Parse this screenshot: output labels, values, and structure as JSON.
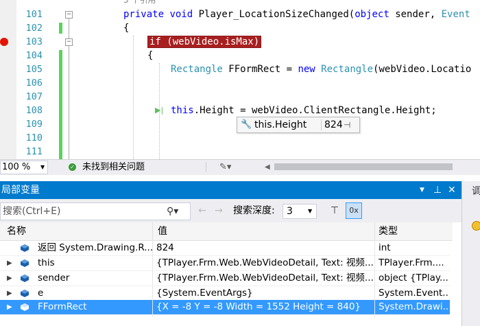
{
  "editor": {
    "codelens": "5 个引用",
    "lines": [
      {
        "num": "101"
      },
      {
        "num": "102"
      },
      {
        "num": "103"
      },
      {
        "num": "104"
      },
      {
        "num": "105"
      },
      {
        "num": "106"
      },
      {
        "num": "107"
      },
      {
        "num": "108"
      },
      {
        "num": "109"
      },
      {
        "num": "110"
      },
      {
        "num": "111"
      }
    ],
    "code": {
      "l101_kw1": "private",
      "l101_kw2": "void",
      "l101_name": " Player_LocationSizeChanged(",
      "l101_kw3": "object",
      "l101_rest": " sender, ",
      "l101_type": "Event",
      "l102": "{",
      "l103": "if (webVideo.isMax)",
      "l104": "{",
      "l105_type1": "Rectangle",
      "l105_mid": " FFormRect = ",
      "l105_kw": "new",
      "l105_type2": "Rectangle",
      "l105_rest": "(webVideo.Locatio",
      "l108_kw": "this",
      "l108_rest": ".Height = webVideo.ClientRectangle.Height;"
    },
    "datatip": {
      "expression": "this.Height",
      "value": "824"
    }
  },
  "status": {
    "zoom": "100 %",
    "issues": "未找到相关问题"
  },
  "locals": {
    "title": "局部变量",
    "search_placeholder": "搜索(Ctrl+E)",
    "search_depth_label": "搜索深度:",
    "search_depth_value": "3",
    "columns": [
      "名称",
      "值",
      "类型"
    ],
    "rows": [
      {
        "expander": "",
        "name": "返回 System.Drawing.R...",
        "value": "824",
        "type": "int"
      },
      {
        "expander": "▶",
        "name": "this",
        "value": "{TPlayer.Frm.Web.WebVideoDetail, Text: 视频...",
        "type": "TPlayer.Frm...."
      },
      {
        "expander": "▶",
        "name": "sender",
        "value": "{TPlayer.Frm.Web.WebVideoDetail, Text: 视频...",
        "type": "object {TPlay..."
      },
      {
        "expander": "▶",
        "name": "e",
        "value": "{System.EventArgs}",
        "type": "System.Event..."
      },
      {
        "expander": "▶",
        "name": "FFormRect",
        "value": "{X = -8 Y = -8 Width = 1552 Height = 840}",
        "type": "System.Drawi..."
      }
    ]
  },
  "side_panel": {
    "label": "调"
  },
  "colors": {
    "accent": "#007acc",
    "selection": "#3399ff",
    "breakpoint": "#e51400",
    "change_bar": "#5bd35b"
  }
}
